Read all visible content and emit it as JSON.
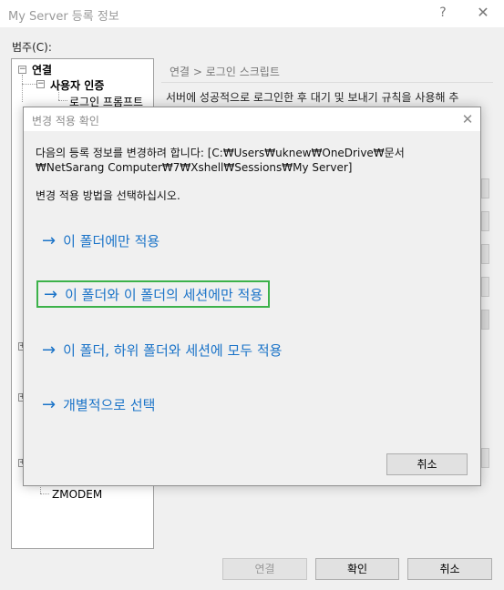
{
  "window": {
    "title": "My Server 등록 정보",
    "help": "?",
    "close": "✕"
  },
  "category_label": "범주(C):",
  "tree": {
    "connection": "연결",
    "user_auth": "사용자 인증",
    "login_prompt": "로그인 프롬프트",
    "zmodem": "ZMODEM"
  },
  "breadcrumb": "연결 > 로그인 스크립트",
  "description": "서버에 성공적으로 로그인한 후 대기 및 보내기 규칙을 사용해 추",
  "buttons": {
    "connect": "연결",
    "ok": "확인",
    "cancel": "취소"
  },
  "dialog": {
    "title": "변경 적용 확인",
    "close": "✕",
    "message": "다음의 등록 정보를 변경하려 합니다: [C:₩Users₩uknew₩OneDrive₩문서₩NetSarang Computer₩7₩Xshell₩Sessions₩My Server]",
    "prompt": "변경 적용 방법을 선택하십시오.",
    "options": [
      {
        "arrow": "→",
        "label": "이 폴더에만 적용"
      },
      {
        "arrow": "→",
        "label": "이 폴더와 이 폴더의 세션에만 적용"
      },
      {
        "arrow": "→",
        "label": "이 폴더, 하위 폴더와 세션에 모두 적용"
      },
      {
        "arrow": "→",
        "label": "개별적으로 선택"
      }
    ],
    "cancel": "취소"
  },
  "colors": {
    "link_blue": "#1a73c8",
    "focus_green": "#3cb24a"
  }
}
